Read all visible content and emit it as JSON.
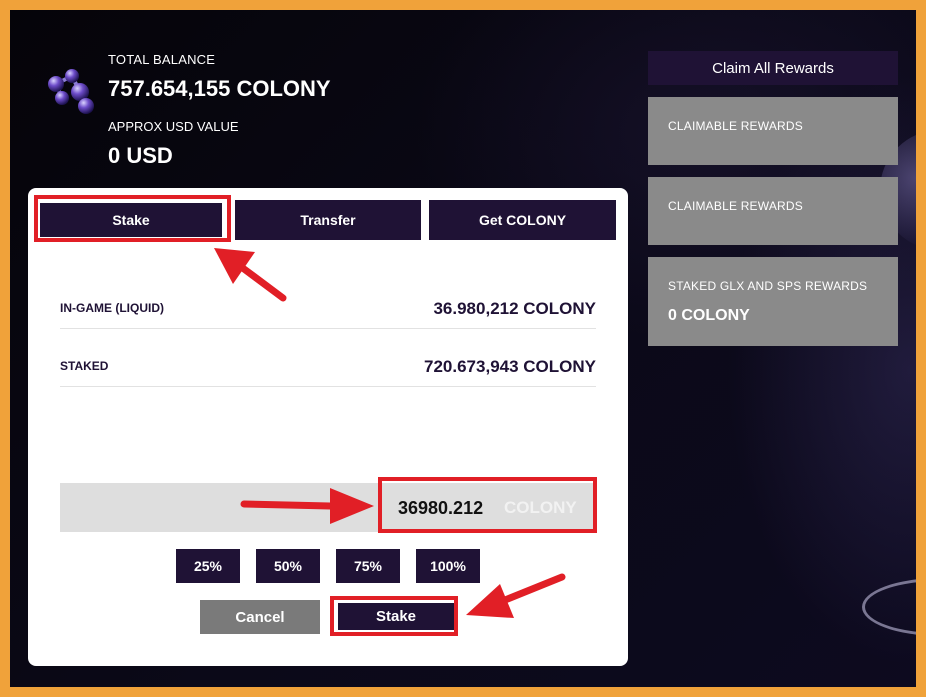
{
  "balance": {
    "total_label": "TOTAL BALANCE",
    "total_value": "757.654,155 COLONY",
    "usd_label": "APPROX USD VALUE",
    "usd_value": "0 USD"
  },
  "tabs": [
    {
      "label": "Stake",
      "active": true
    },
    {
      "label": "Transfer"
    },
    {
      "label": "Get COLONY"
    }
  ],
  "rows": [
    {
      "label": "IN-GAME (LIQUID)",
      "value": "36.980,212 COLONY"
    },
    {
      "label": "STAKED",
      "value": "720.673,943 COLONY"
    }
  ],
  "amount": {
    "value": "36980.212",
    "unit": "COLONY"
  },
  "percent_buttons": [
    "25%",
    "50%",
    "75%",
    "100%"
  ],
  "actions": {
    "cancel_label": "Cancel",
    "stake_label": "Stake"
  },
  "side": {
    "claim_all_label": "Claim All Rewards",
    "cards": [
      {
        "title": "CLAIMABLE REWARDS"
      },
      {
        "title": "CLAIMABLE REWARDS"
      },
      {
        "title": "STAKED GLX AND SPS REWARDS",
        "value": "0 COLONY"
      }
    ]
  },
  "colors": {
    "frame_border": "#f0a23a",
    "accent_dark": "#1f1235",
    "highlight_red": "#e11f26",
    "card_gray": "#8a8a8a"
  }
}
